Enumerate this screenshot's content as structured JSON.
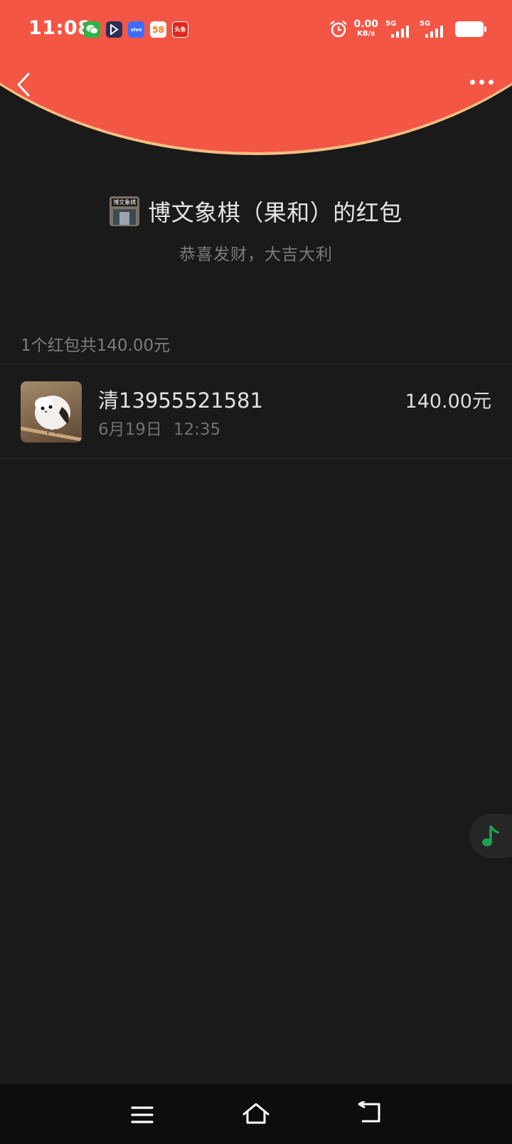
{
  "status_bar": {
    "time": "11:08",
    "app_icons": [
      "wechat-icon",
      "p-app-icon",
      "vivo-icon",
      "58-icon",
      "toutiao-icon"
    ],
    "icon_labels": {
      "vivo": "vivo",
      "fifty_eight": "58",
      "toutiao": "头条"
    },
    "net_speed": "0.00",
    "net_unit": "KB/s",
    "sim1": "5G",
    "sim2": "5G"
  },
  "header": {
    "title": "博文象棋（果和）的红包",
    "subtitle": "恭喜发财，大吉大利",
    "avatar_sign": "博文象棋"
  },
  "summary": "1个红包共140.00元",
  "records": [
    {
      "name": "清13955521581",
      "date": "6月19日",
      "time": "12:35",
      "amount": "140.00元"
    }
  ],
  "colors": {
    "header_red": "#f45646",
    "arc_edge": "#f2c183",
    "background": "#1a1a1a",
    "music_green": "#1fa04f"
  }
}
